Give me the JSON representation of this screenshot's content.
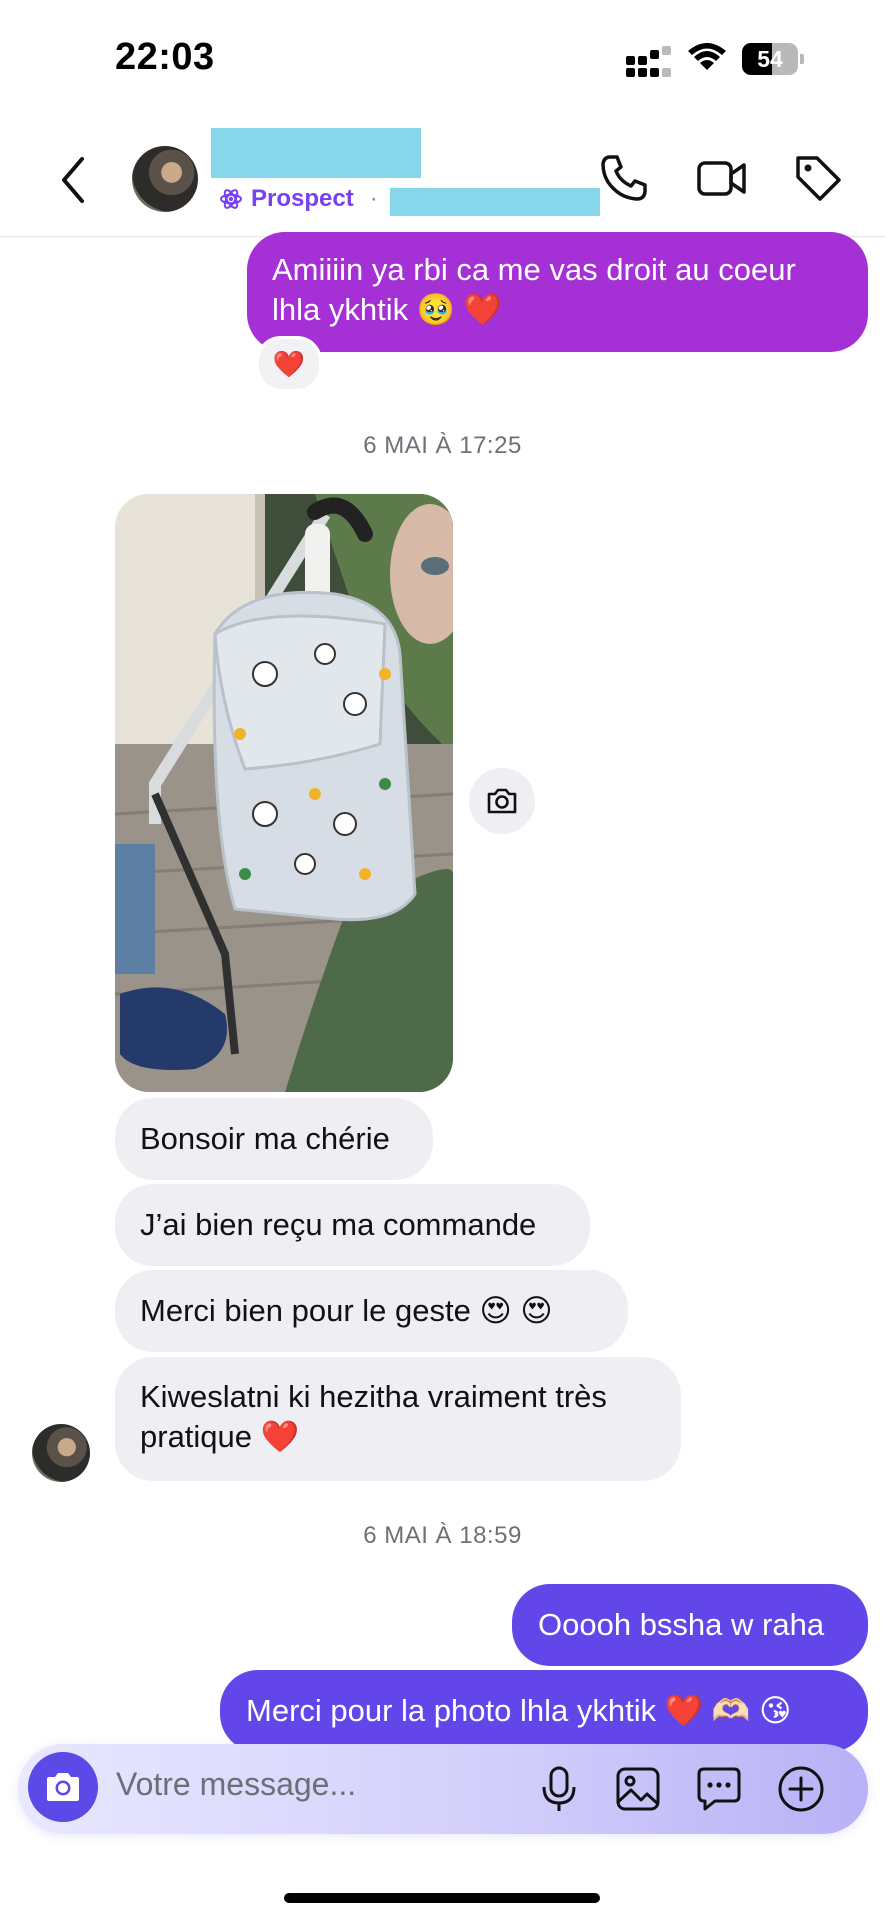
{
  "status_bar": {
    "time": "22:03",
    "battery": "54",
    "battery_level": 0.54
  },
  "header": {
    "tag": "Prospect",
    "separator": "·"
  },
  "messages": {
    "m1": "Amiiiin ya rbi ca me vas droit au coeur lhla ykhtik 🥹 ❤️",
    "m1_reaction": "❤️",
    "stamp1": "6 MAI À 17:25",
    "in1": "Bonsoir ma chérie",
    "in2": "J’ai bien reçu ma commande",
    "in3": "Merci bien pour le geste 😍 😍",
    "in4": "Kiweslatni ki hezitha vraiment très pratique ❤️",
    "stamp2": "6 MAI À 18:59",
    "out2": "Ooooh bssha w raha",
    "out3": "Merci pour la photo lhla ykhtik ❤️ 🫶🏻 😘"
  },
  "composer": {
    "placeholder": "Votre message..."
  },
  "colors": {
    "accent": "#6246ea",
    "purple_bubble": "#a531d6",
    "incoming_bubble": "#efeff3",
    "prospect": "#7a3ff0"
  }
}
